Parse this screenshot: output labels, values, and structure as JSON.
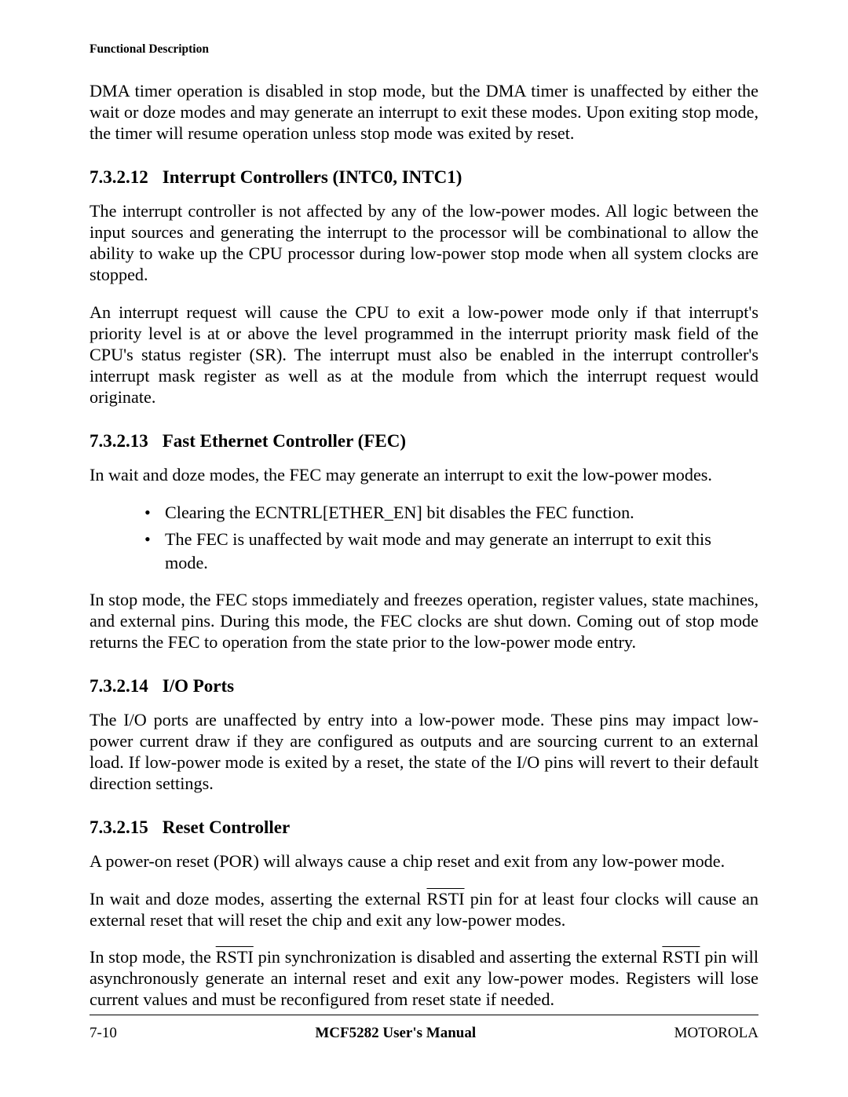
{
  "header": {
    "running": "Functional Description"
  },
  "intro": "DMA timer operation is disabled in stop mode, but the DMA timer is unaffected by either the wait or doze modes and may generate an interrupt to exit these modes. Upon exiting stop mode, the timer will resume operation unless stop mode was exited by reset.",
  "s12": {
    "num": "7.3.2.12",
    "title": "Interrupt Controllers (INTC0, INTC1)",
    "p1": "The interrupt controller is not affected by any of the low-power modes. All logic between the input sources and generating the interrupt to the processor will be combinational to allow the ability to wake up the CPU processor during low-power stop mode when all system clocks are stopped.",
    "p2": "An interrupt request will cause the CPU to exit a low-power mode only if that interrupt's priority level is at or above the level programmed in the interrupt priority mask field of the CPU's status register (SR). The interrupt must also be enabled in the interrupt controller's interrupt mask register as well as at the module from which the interrupt request would originate."
  },
  "s13": {
    "num": "7.3.2.13",
    "title": "Fast Ethernet Controller (FEC)",
    "p1": "In wait and doze modes, the FEC may generate an interrupt to exit the low-power modes.",
    "b1": "Clearing the ECNTRL[ETHER_EN] bit disables the FEC function.",
    "b2": "The FEC is unaffected by wait mode and may generate an interrupt to exit this mode.",
    "p2": "In stop mode, the FEC stops immediately and freezes operation, register values, state machines, and external pins. During this mode, the FEC clocks are shut down. Coming out of stop mode returns the FEC to operation from the state prior to the low-power mode entry."
  },
  "s14": {
    "num": "7.3.2.14",
    "title": "I/O Ports",
    "p1": "The I/O ports are unaffected by entry into a low-power mode. These pins may impact low-power current draw if they are configured as outputs and are sourcing current to an external load. If low-power mode is exited by a reset, the state of the I/O pins will revert to their default direction settings."
  },
  "s15": {
    "num": "7.3.2.15",
    "title": "Reset Controller",
    "p1": "A power-on reset (POR) will always cause a chip reset and exit from any low-power mode.",
    "p2a": "In wait and doze modes, asserting the external ",
    "p2b": " pin for at least four clocks will cause an external reset that will reset the chip and exit any low-power modes.",
    "p3a": "In stop mode, the ",
    "p3b": " pin synchronization is disabled and asserting the external ",
    "p3c": " pin will asynchronously generate an internal reset and exit any low-power modes. Registers will lose current values and must be reconfigured from reset state if needed.",
    "rsti": "RSTI"
  },
  "footer": {
    "left": "7-10",
    "center": "MCF5282 User's Manual",
    "right": "MOTOROLA"
  }
}
